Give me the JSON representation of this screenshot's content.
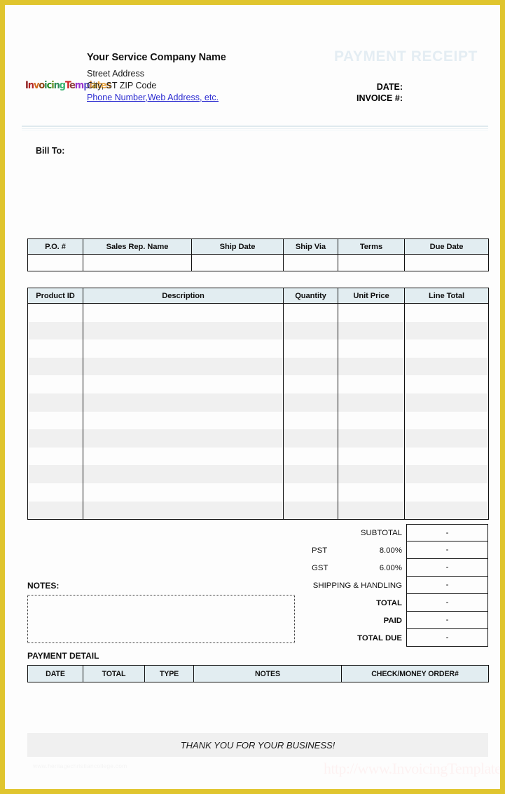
{
  "page": {
    "border_color": "#e0c52e",
    "background": "#fdfdfd"
  },
  "header": {
    "logo": {
      "name": "invoicing-templates-logo",
      "letters": [
        {
          "ch": "I",
          "color": "#8b1a1a"
        },
        {
          "ch": "n",
          "color": "#b22222"
        },
        {
          "ch": "v",
          "color": "#d2691e"
        },
        {
          "ch": "o",
          "color": "#8b4513"
        },
        {
          "ch": "i",
          "color": "#2e8b57"
        },
        {
          "ch": "c",
          "color": "#228b22"
        },
        {
          "ch": "i",
          "color": "#6b8e23"
        },
        {
          "ch": "n",
          "color": "#2e8b57"
        },
        {
          "ch": "g",
          "color": "#3cb371"
        },
        {
          "ch": "T",
          "color": "#cc2222"
        },
        {
          "ch": "e",
          "color": "#8b3a3a"
        },
        {
          "ch": "m",
          "color": "#9932cc"
        },
        {
          "ch": "p",
          "color": "#6a5acd"
        },
        {
          "ch": "l",
          "color": "#cd853f"
        },
        {
          "ch": "a",
          "color": "#daa520"
        },
        {
          "ch": "t",
          "color": "#e8a33d"
        },
        {
          "ch": "e",
          "color": "#e8a33d"
        },
        {
          "ch": "s",
          "color": "#cc8833"
        }
      ]
    },
    "company_name": "Your Service Company Name",
    "address_line1": "Street Address",
    "address_line2": "City, ST  ZIP Code",
    "address_line3": "Phone Number,Web Address, etc.",
    "title": "PAYMENT RECEIPT",
    "title_color": "#e4edf3",
    "date_label": "DATE:",
    "invoice_label": "INVOICE #:",
    "date_value": "",
    "invoice_value": ""
  },
  "bill_to": {
    "label": "Bill To:",
    "value": ""
  },
  "info_table": {
    "headers": [
      "P.O. #",
      "Sales Rep. Name",
      "Ship Date",
      "Ship Via",
      "Terms",
      "Due Date"
    ],
    "row": [
      "",
      "",
      "",
      "",
      "",
      ""
    ],
    "header_bg": "#e2edf1"
  },
  "items_table": {
    "headers": [
      "Product ID",
      "Description",
      "Quantity",
      "Unit Price",
      "Line Total"
    ],
    "row_count": 12,
    "rows": [
      [
        "",
        "",
        "",
        "",
        ""
      ],
      [
        "",
        "",
        "",
        "",
        ""
      ],
      [
        "",
        "",
        "",
        "",
        ""
      ],
      [
        "",
        "",
        "",
        "",
        ""
      ],
      [
        "",
        "",
        "",
        "",
        ""
      ],
      [
        "",
        "",
        "",
        "",
        ""
      ],
      [
        "",
        "",
        "",
        "",
        ""
      ],
      [
        "",
        "",
        "",
        "",
        ""
      ],
      [
        "",
        "",
        "",
        "",
        ""
      ],
      [
        "",
        "",
        "",
        "",
        ""
      ],
      [
        "",
        "",
        "",
        "",
        ""
      ],
      [
        "",
        "",
        "",
        "",
        ""
      ]
    ],
    "header_bg": "#e2edf1",
    "stripe_color": "#f0f0f0"
  },
  "totals": [
    {
      "label": "SUBTOTAL",
      "tax_name": "",
      "rate": "",
      "value": "-",
      "bold": false
    },
    {
      "label": "",
      "tax_name": "PST",
      "rate": "8.00%",
      "value": "-",
      "bold": false
    },
    {
      "label": "",
      "tax_name": "GST",
      "rate": "6.00%",
      "value": "-",
      "bold": false
    },
    {
      "label": "SHIPPING & HANDLING",
      "tax_name": "",
      "rate": "",
      "value": "-",
      "bold": false
    },
    {
      "label": "TOTAL",
      "tax_name": "",
      "rate": "",
      "value": "-",
      "bold": true
    },
    {
      "label": "PAID",
      "tax_name": "",
      "rate": "",
      "value": "-",
      "bold": true
    },
    {
      "label": "TOTAL DUE",
      "tax_name": "",
      "rate": "",
      "value": "-",
      "bold": true
    }
  ],
  "notes": {
    "label": "NOTES:",
    "value": ""
  },
  "payment_detail": {
    "label": "PAYMENT DETAIL",
    "headers": [
      "DATE",
      "TOTAL",
      "TYPE",
      "NOTES",
      "CHECK/MONEY ORDER#"
    ],
    "header_bg": "#e2edf1"
  },
  "footer": {
    "thank_you": "THANK YOU FOR YOUR BUSINESS!",
    "thank_you_bg": "#f0f0f0",
    "watermark_left": "www.heritagechristiancollege.com",
    "watermark_right": "http://www.InvoicingTemplate.com"
  }
}
